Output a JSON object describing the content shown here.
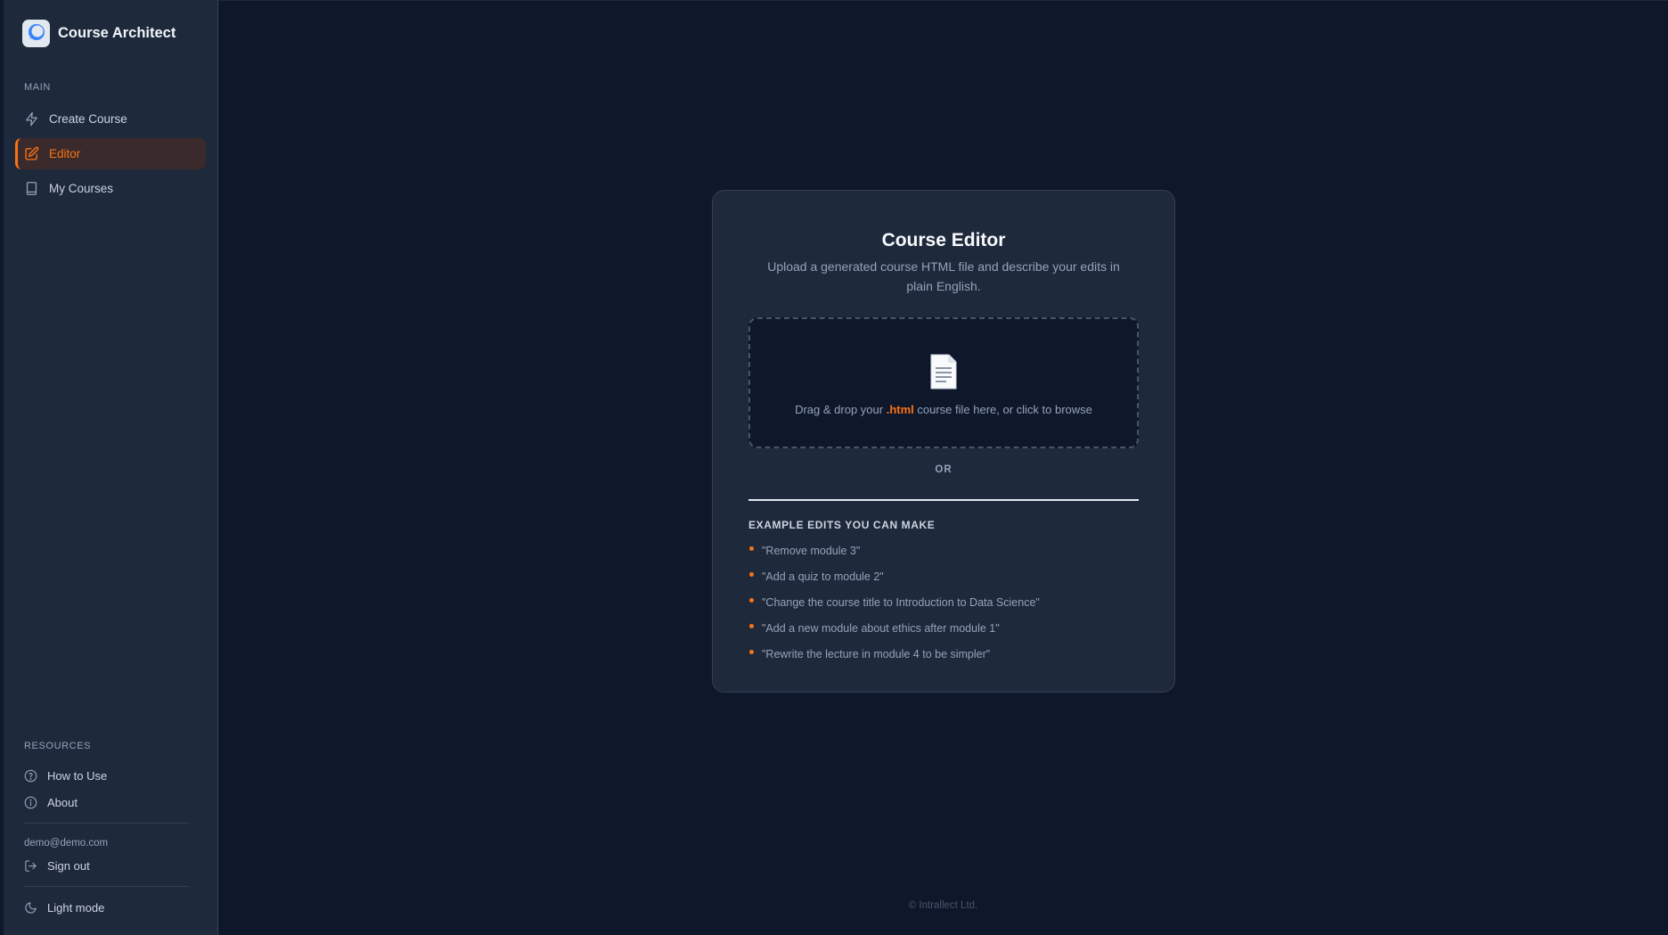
{
  "brand": {
    "title": "Course Architect",
    "logo_icon": "chat-bubble-logo-icon"
  },
  "sidebar": {
    "main_label": "MAIN",
    "items": [
      {
        "label": "Create Course",
        "icon": "lightning-icon",
        "active": false
      },
      {
        "label": "Editor",
        "icon": "edit-icon",
        "active": true
      },
      {
        "label": "My Courses",
        "icon": "book-icon",
        "active": false
      }
    ],
    "resources_label": "RESOURCES",
    "resources": [
      {
        "label": "How to Use",
        "icon": "help-circle-icon"
      },
      {
        "label": "About",
        "icon": "info-circle-icon"
      }
    ],
    "email": "demo@demo.com",
    "sign_out": "Sign out",
    "theme_toggle": "Light mode"
  },
  "editor": {
    "title": "Course Editor",
    "subtitle": "Upload a generated course HTML file and describe your edits in plain English.",
    "dropzone": {
      "icon": "document-icon",
      "text_before": "Drag & drop your ",
      "ext": ".html",
      "text_after": " course file here, or click to browse"
    },
    "or_label": "OR",
    "examples_title": "EXAMPLE EDITS YOU CAN MAKE",
    "examples": [
      "\"Remove module 3\"",
      "\"Add a quiz to module 2\"",
      "\"Change the course title to Introduction to Data Science\"",
      "\"Add a new module about ethics after module 1\"",
      "\"Rewrite the lecture in module 4 to be simpler\""
    ]
  },
  "footer": "© Intrallect Ltd.",
  "colors": {
    "accent": "#f97316",
    "background": "#0f172a",
    "panel": "#1e293b"
  }
}
